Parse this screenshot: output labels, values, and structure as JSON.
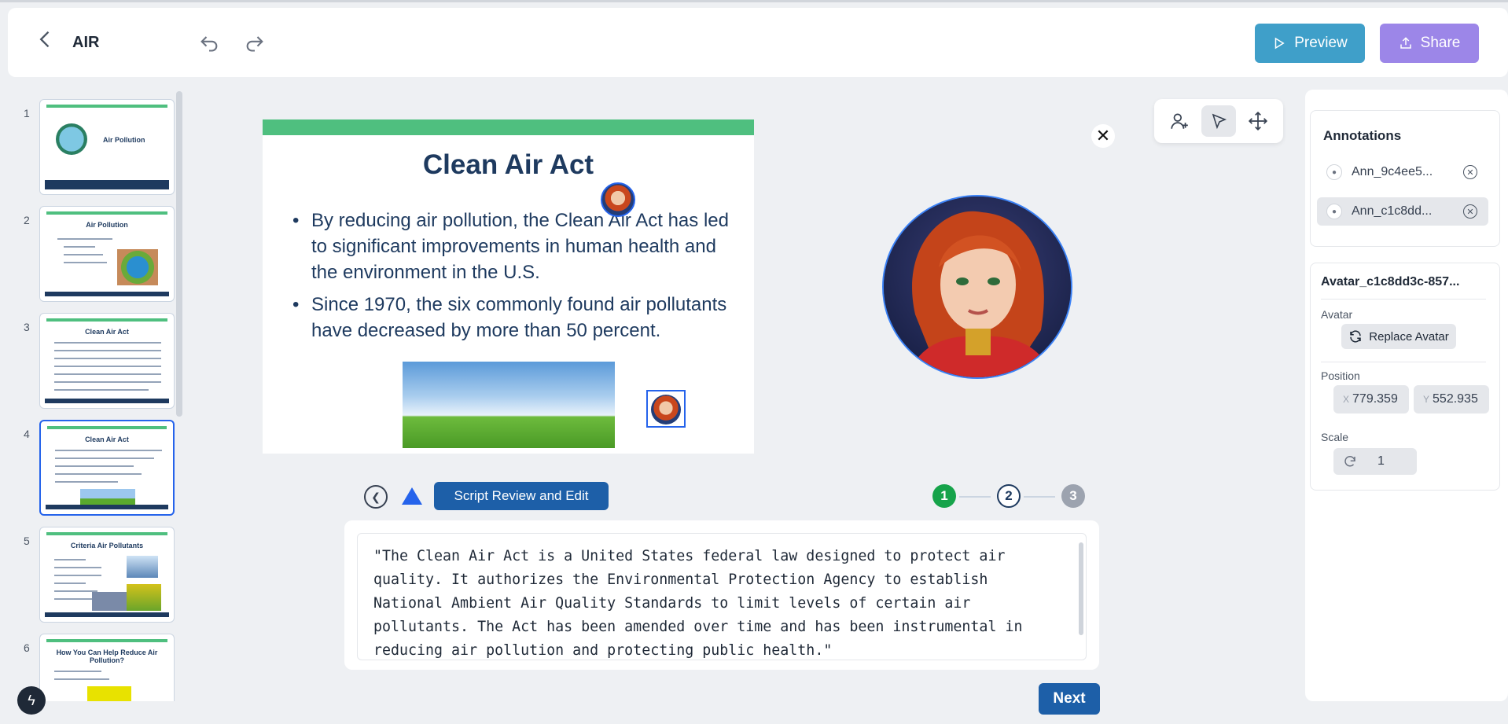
{
  "app": {
    "title": "AIR"
  },
  "toolbar": {
    "preview_label": "Preview",
    "share_label": "Share"
  },
  "thumbnails": [
    {
      "number": "1",
      "title": "Air Pollution"
    },
    {
      "number": "2",
      "title": "Air Pollution"
    },
    {
      "number": "3",
      "title": "Clean Air Act"
    },
    {
      "number": "4",
      "title": "Clean Air Act"
    },
    {
      "number": "5",
      "title": "Criteria Air Pollutants"
    },
    {
      "number": "6",
      "title": "How You Can Help Reduce Air Pollution?"
    }
  ],
  "slide": {
    "title": "Clean Air Act",
    "bullets": [
      "By reducing air pollution, the Clean Air Act has led to significant improvements in human health and the environment in the U.S.",
      "Since 1970, the six commonly found air pollutants have decreased by more than 50 percent."
    ]
  },
  "script": {
    "label": "Script Review and Edit",
    "text": "\"The Clean Air Act is a United States federal law designed to protect air quality. It authorizes the Environmental Protection Agency to establish National Ambient Air Quality Standards to limit levels of certain air pollutants. The Act has been amended over time and has been instrumental in reducing air pollution and protecting public health.\"",
    "next_label": "Next",
    "steps": [
      "1",
      "2",
      "3"
    ]
  },
  "annotations": {
    "title": "Annotations",
    "items": [
      {
        "name": "Ann_9c4ee5...",
        "selected": false
      },
      {
        "name": "Ann_c1c8dd...",
        "selected": true
      }
    ]
  },
  "properties": {
    "name": "Avatar_c1c8dd3c-857...",
    "avatar_label": "Avatar",
    "replace_label": "Replace Avatar",
    "position_label": "Position",
    "x_axis": "X",
    "x_value": "779.359",
    "y_axis": "Y",
    "y_value": "552.935",
    "scale_label": "Scale",
    "scale_value": "1"
  },
  "colors": {
    "preview": "#3f9fc9",
    "share": "#9c86e8",
    "primary": "#1d5fa8",
    "slide_green": "#4fbf7f",
    "step_done": "#16a34a"
  }
}
